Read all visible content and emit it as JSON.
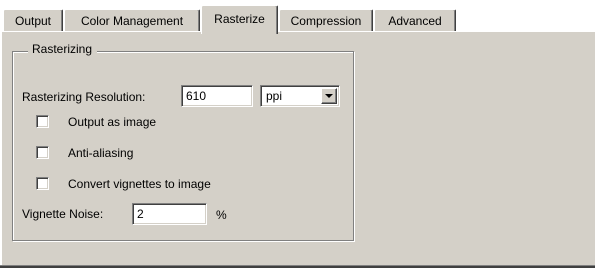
{
  "tabs": [
    {
      "label": "Output"
    },
    {
      "label": "Color Management"
    },
    {
      "label": "Rasterize",
      "active": true
    },
    {
      "label": "Compression"
    },
    {
      "label": "Advanced"
    }
  ],
  "group": {
    "title": "Rasterizing"
  },
  "resolution": {
    "label": "Rasterizing Resolution:",
    "value": "610",
    "unit": "ppi"
  },
  "checkboxes": [
    {
      "label": "Output as image",
      "checked": false
    },
    {
      "label": "Anti-aliasing",
      "checked": false
    },
    {
      "label": "Convert vignettes to image",
      "checked": false
    }
  ],
  "noise": {
    "label": "Vignette Noise:",
    "value": "2",
    "unit": "%"
  },
  "colors": {
    "face": "#d4d0c8",
    "shadow": "#808080",
    "highlight": "#ffffff"
  }
}
